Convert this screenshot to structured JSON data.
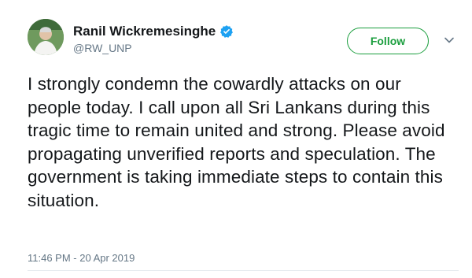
{
  "author": {
    "display_name": "Ranil Wickremesinghe",
    "handle": "@RW_UNP",
    "verified": true,
    "avatar": "avatar-photo"
  },
  "actions": {
    "follow_label": "Follow",
    "more_icon": "chevron-down-icon"
  },
  "tweet": {
    "text": "I strongly condemn the cowardly attacks on our people today. I call upon all Sri Lankans during this tragic time to remain united and strong. Please avoid propagating unverified reports and speculation. The government is taking immediate steps to contain this situation.",
    "timestamp": "11:46 PM - 20 Apr 2019"
  },
  "colors": {
    "accent_green": "#1b9e3e",
    "verified_blue": "#1da1f2",
    "secondary_text": "#657786"
  }
}
